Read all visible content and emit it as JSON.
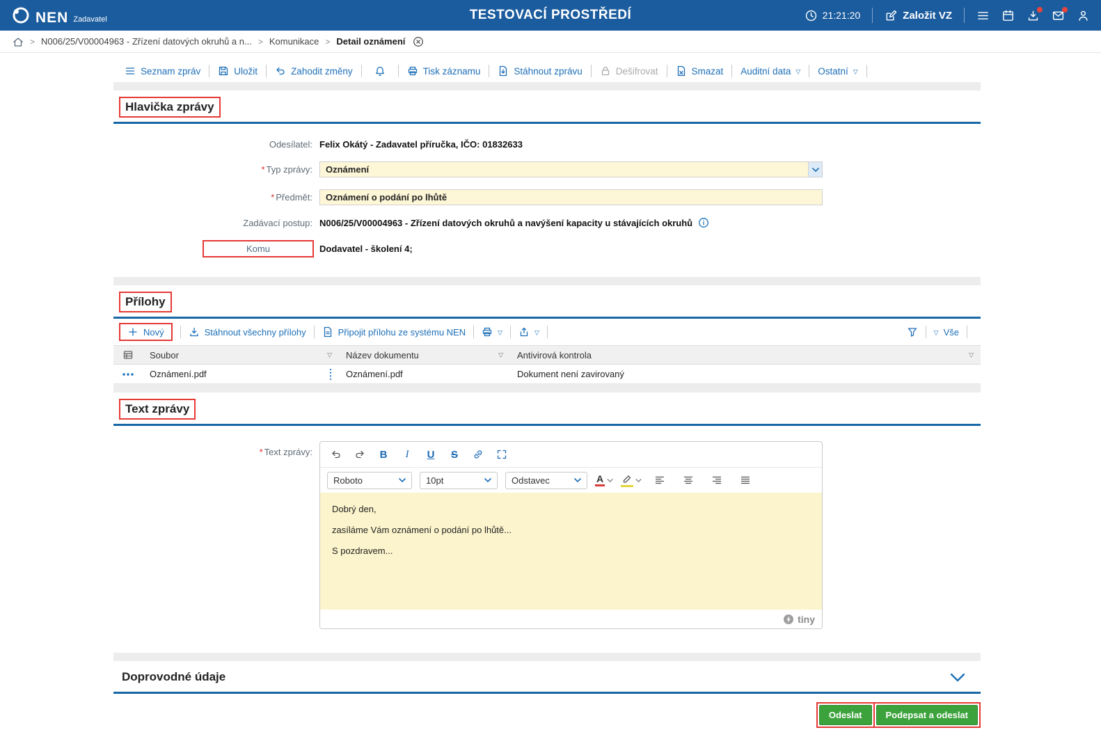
{
  "misc": {
    "required_mark": "*"
  },
  "icons": {
    "crumb_sep": ">",
    "chev": "▽"
  },
  "colors": {
    "topbar_blue": "#1b5c9e",
    "link_blue": "#1d6fb8",
    "section_rule_blue": "#1766a6",
    "annotation_red": "#e53935",
    "field_yellow": "#fdf7d7",
    "editor_yellow": "#fbf4cc",
    "button_green": "#3ca23c",
    "badge_red": "#e8453c"
  },
  "topbar": {
    "brand": "NEN",
    "brand_sub": "Zadavatel",
    "env_title": "TESTOVACÍ PROSTŘEDÍ",
    "time": "21:21:20",
    "create_button": "Založit VZ"
  },
  "breadcrumb": {
    "item1": "N006/25/V00004963 - Zřízení datových okruhů a n...",
    "item2": "Komunikace",
    "item3": "Detail oznámení"
  },
  "toolbar": {
    "seznam": "Seznam zpráv",
    "ulozit": "Uložit",
    "zahodit": "Zahodit změny",
    "tisk": "Tisk záznamu",
    "stahnout": "Stáhnout zprávu",
    "desifrovat": "Dešifrovat",
    "smazat": "Smazat",
    "auditni": "Auditní data",
    "ostatni": "Ostatní"
  },
  "hlavicka": {
    "title": "Hlavička zprávy",
    "odesilatel_label": "Odesílatel:",
    "odesilatel_value": "Felix Okátý - Zadavatel příručka, IČO: 01832633",
    "typ_label": "Typ zprávy:",
    "typ_value": "Oznámení",
    "predmet_label": "Předmět:",
    "predmet_value": "Oznámení o podání po lhůtě",
    "postup_label": "Zadávací postup:",
    "postup_value": "N006/25/V00004963 - Zřízení datových okruhů a navýšení kapacity u stávajících okruhů",
    "komu_label": "Komu",
    "komu_value": "Dodavatel - školení 4;"
  },
  "prilohy": {
    "title": "Přílohy",
    "novy": "Nový",
    "stahnout": "Stáhnout všechny přílohy",
    "pripojit": "Připojit přílohu ze systému NEN",
    "vse": "Vše",
    "col_soubor": "Soubor",
    "col_nazev": "Název dokumentu",
    "col_antivir": "Antivirová kontrola",
    "rows": [
      {
        "soubor": "Oznámení.pdf",
        "nazev": "Oznámení.pdf",
        "antivir": "Dokument není zavirovaný"
      }
    ]
  },
  "editor": {
    "title": "Text zprávy",
    "field_label": "Text zprávy:",
    "bold": "B",
    "italic": "I",
    "underline": "U",
    "strike": "S",
    "font_name": "Roboto",
    "font_size": "10pt",
    "paragraph": "Odstavec",
    "color_letter": "A",
    "line1": "Dobrý den,",
    "line2": "zasíláme Vám oznámení o podání po lhůtě...",
    "line3": "S pozdravem...",
    "tiny": "tiny"
  },
  "doprovodne": {
    "title": "Doprovodné údaje"
  },
  "actions": {
    "odeslat": "Odeslat",
    "podepsat": "Podepsat a odeslat"
  }
}
